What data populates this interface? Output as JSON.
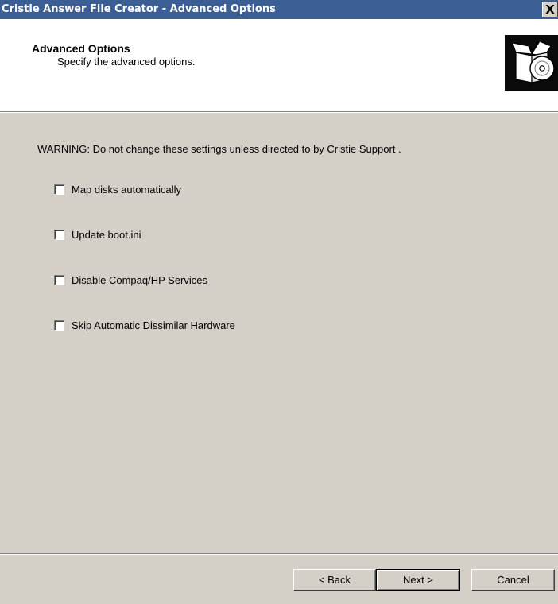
{
  "window": {
    "title": "Cristie Answer File Creator - Advanced Options",
    "close_label": "X"
  },
  "header": {
    "title": "Advanced Options",
    "subtitle": "Specify the advanced options.",
    "icon": "box-with-cd-icon"
  },
  "main": {
    "warning": "WARNING: Do not change these settings unless directed to by Cristie Support .",
    "options": [
      {
        "label": "Map disks automatically",
        "checked": false
      },
      {
        "label": "Update boot.ini",
        "checked": false
      },
      {
        "label": "Disable Compaq/HP Services",
        "checked": false
      },
      {
        "label": "Skip Automatic Dissimilar Hardware",
        "checked": false
      }
    ]
  },
  "footer": {
    "back_label": "< Back",
    "next_label": "Next >",
    "cancel_label": "Cancel"
  },
  "colors": {
    "titlebar": "#3b5f94",
    "dialog_background": "#d4d0c8",
    "header_background": "#ffffff"
  }
}
